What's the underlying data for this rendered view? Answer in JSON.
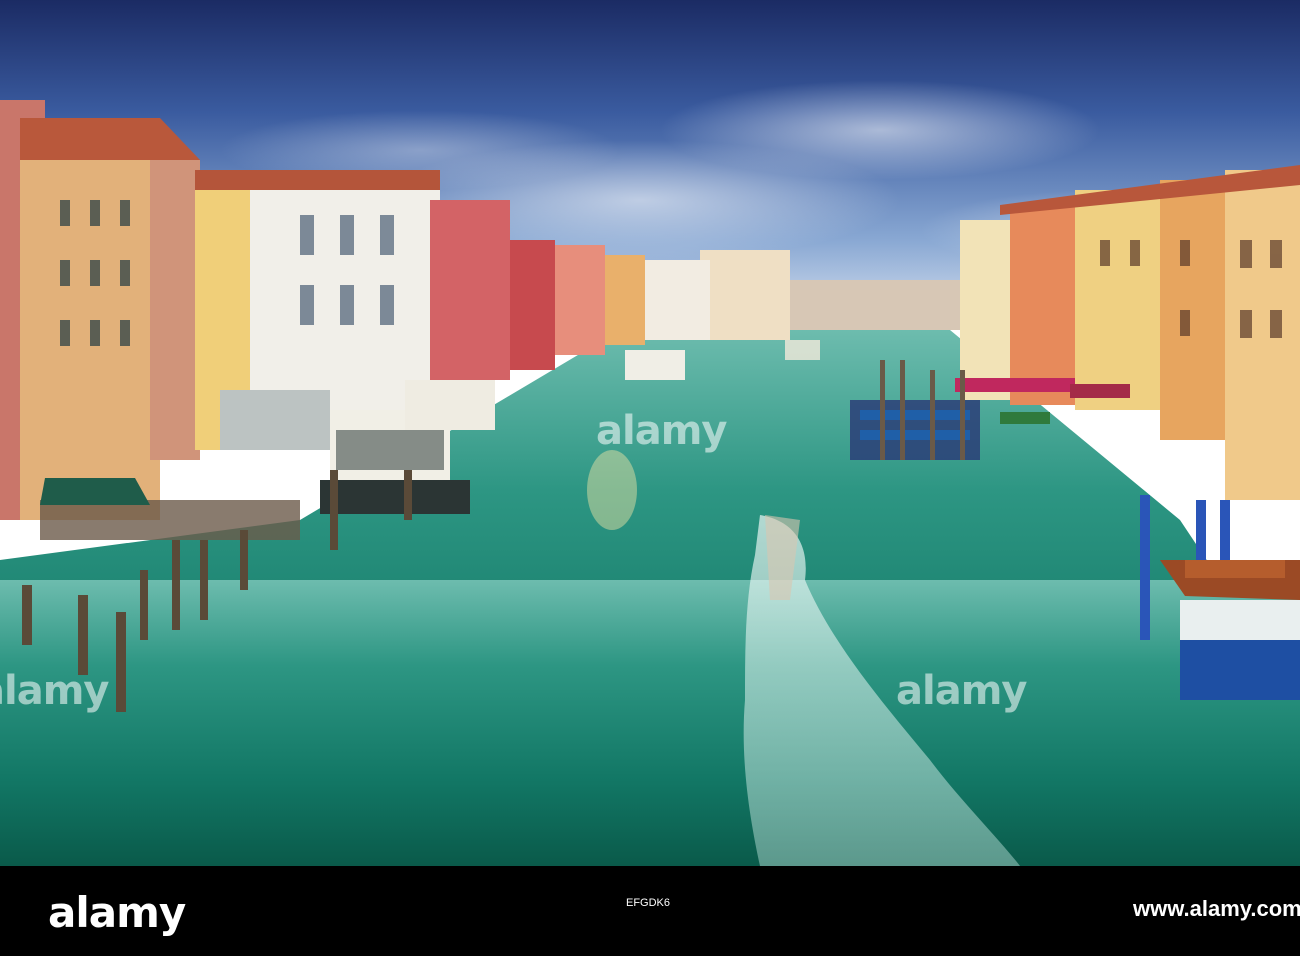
{
  "photo": {
    "subject": "Grand Canal Venice",
    "colors": {
      "sky_top": "#1e2f6b",
      "sky_mid": "#4f76b6",
      "sky_low": "#c6d5ea",
      "water_near": "#0e6a58",
      "water_far": "#5fb3a7",
      "wake": "#e8f5f2"
    }
  },
  "watermarks": {
    "center": "alamy",
    "left": "alamy",
    "right": "alamy"
  },
  "footer": {
    "brand": "alamy",
    "image_id": "EFGDK6",
    "url": "www.alamy.com"
  }
}
